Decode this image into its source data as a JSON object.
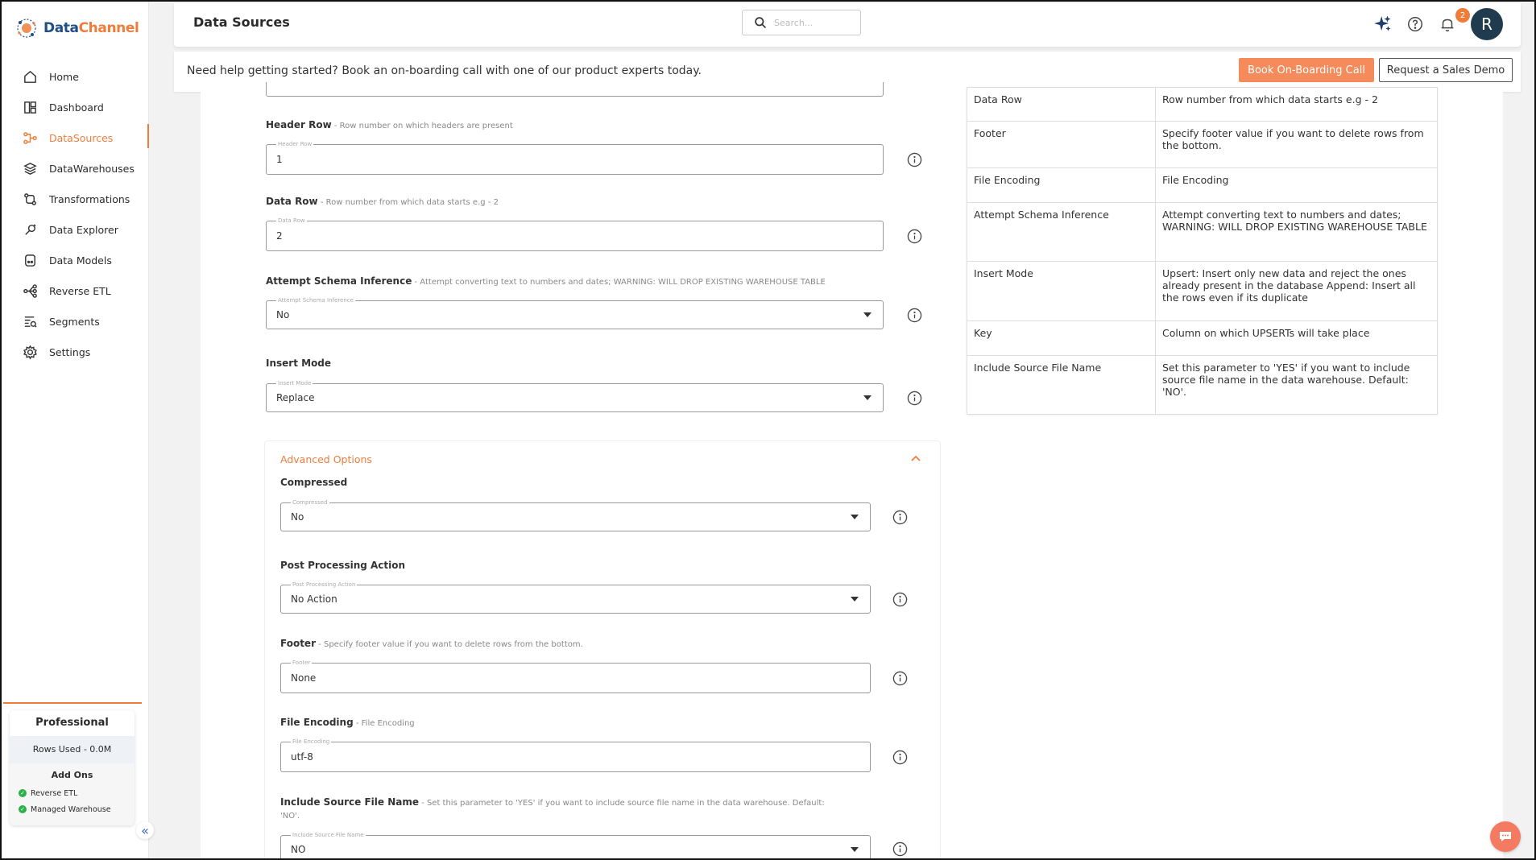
{
  "app": {
    "logo_part1": "Data",
    "logo_part2": "Channel"
  },
  "sidebar": {
    "items": [
      {
        "label": "Home",
        "icon": "home-icon",
        "active": false
      },
      {
        "label": "Dashboard",
        "icon": "dashboard-icon",
        "active": false
      },
      {
        "label": "DataSources",
        "icon": "datasources-icon",
        "active": true
      },
      {
        "label": "DataWarehouses",
        "icon": "datawarehouses-icon",
        "active": false
      },
      {
        "label": "Transformations",
        "icon": "transformations-icon",
        "active": false
      },
      {
        "label": "Data Explorer",
        "icon": "data-explorer-icon",
        "active": false
      },
      {
        "label": "Data Models",
        "icon": "data-models-icon",
        "active": false
      },
      {
        "label": "Reverse ETL",
        "icon": "reverse-etl-icon",
        "active": false
      },
      {
        "label": "Segments",
        "icon": "segments-icon",
        "active": false
      },
      {
        "label": "Settings",
        "icon": "settings-icon",
        "active": false
      }
    ],
    "plan": {
      "name": "Professional",
      "rows_used": "Rows Used - 0.0M",
      "addons_title": "Add Ons",
      "addons": [
        "Reverse ETL",
        "Managed Warehouse"
      ]
    },
    "collapse_glyph": "«"
  },
  "header": {
    "title": "Data Sources",
    "search_placeholder": "Search...",
    "notification_count": "2",
    "avatar_initial": "R"
  },
  "banner": {
    "text": "Need help getting started? Book an on-boarding call with one of our product experts today.",
    "primary_button": "Book On-Boarding Call",
    "secondary_button": "Request a Sales Demo"
  },
  "form": {
    "header_row": {
      "title": "Header Row",
      "hint": " - Row number on which headers are present",
      "label": "Header Row",
      "value": "1"
    },
    "data_row": {
      "title": "Data Row",
      "hint": " - Row number from which data starts e.g - 2",
      "label": "Data Row",
      "value": "2"
    },
    "schema_inference": {
      "title": "Attempt Schema Inference",
      "hint": " - Attempt converting text to numbers and dates; WARNING: WILL DROP EXISTING WAREHOUSE TABLE",
      "label": "Attempt Schema Inference",
      "value": "No"
    },
    "insert_mode": {
      "title": "Insert Mode",
      "label": "Insert Mode",
      "value": "Replace"
    },
    "advanced": {
      "title": "Advanced Options",
      "compressed": {
        "title": "Compressed",
        "label": "Compressed",
        "value": "No"
      },
      "post_processing": {
        "title": "Post Processing Action",
        "label": "Post Processing Action",
        "value": "No Action"
      },
      "footer": {
        "title": "Footer",
        "hint": " - Specify footer value if you want to delete rows from the bottom.",
        "label": "Footer",
        "value": "None"
      },
      "file_encoding": {
        "title": "File Encoding",
        "hint": " - File Encoding",
        "label": "File Encoding",
        "value": "utf-8"
      },
      "include_source": {
        "title": "Include Source File Name",
        "hint_line1": " - Set this parameter to 'YES' if you want to include source file name in the data warehouse. Default:",
        "hint_line2": "'NO'.",
        "label": "Include Source File Name",
        "value": "NO"
      }
    }
  },
  "help_table": {
    "rows": [
      {
        "key": "Data Row",
        "desc": "Row number from which data starts e.g - 2"
      },
      {
        "key": "Footer",
        "desc": "Specify footer value if you want to delete rows from the bottom."
      },
      {
        "key": "File Encoding",
        "desc": "File Encoding"
      },
      {
        "key": "Attempt Schema Inference",
        "desc": "Attempt converting text to numbers and dates; WARNING: WILL DROP EXISTING WAREHOUSE TABLE"
      },
      {
        "key": "Insert Mode",
        "desc": "Upsert: Insert only new data and reject the ones already present in the database Append: Insert all the rows even if its duplicate"
      },
      {
        "key": "Key",
        "desc": "Column on which UPSERTs will take place"
      },
      {
        "key": "Include Source File Name",
        "desc": "Set this parameter to 'YES' if you want to include source file name in the data warehouse. Default: 'NO'."
      }
    ]
  },
  "colors": {
    "accent": "#f07c3c",
    "brand_blue": "#1f4f86",
    "avatar_bg": "#1f3b4d",
    "chat": "#f47b62",
    "check_green": "#2db04b"
  }
}
